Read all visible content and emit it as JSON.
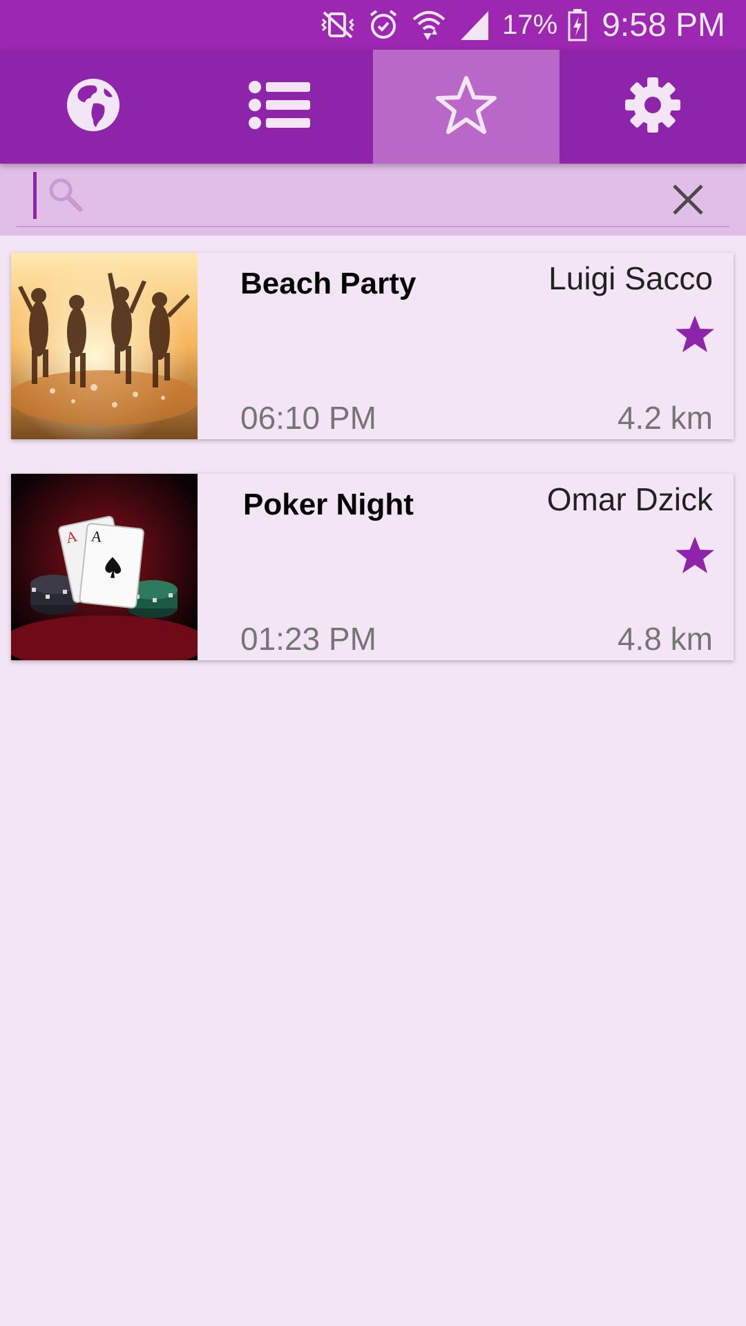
{
  "status_bar": {
    "battery_percent": "17%",
    "time": "9:58 PM",
    "icons": [
      "vibrate-off-icon",
      "alarm-icon",
      "wifi-icon",
      "signal-icon",
      "battery-charging-icon"
    ]
  },
  "tabs": [
    {
      "icon": "globe-icon",
      "active": false
    },
    {
      "icon": "list-icon",
      "active": false
    },
    {
      "icon": "star-outline-icon",
      "active": true
    },
    {
      "icon": "gear-icon",
      "active": false
    }
  ],
  "search": {
    "value": "",
    "placeholder": ""
  },
  "events": [
    {
      "title": "Beach Party",
      "host": "Luigi Sacco",
      "time": "06:10 PM",
      "distance": "4.2 km",
      "favorite": true,
      "thumbnail": "beach-party-photo"
    },
    {
      "title": "Poker Night",
      "host": "Omar Dzick",
      "time": "01:23 PM",
      "distance": "4.8 km",
      "favorite": true,
      "thumbnail": "poker-cards-chips-photo"
    }
  ],
  "colors": {
    "status_bar": "#9C27B0",
    "tab_bar": "#8E24AA",
    "tab_active": "#BA68C8",
    "search_bg": "#E1BEE7",
    "page_bg": "#F3E5F5",
    "star": "#8E24AA"
  }
}
